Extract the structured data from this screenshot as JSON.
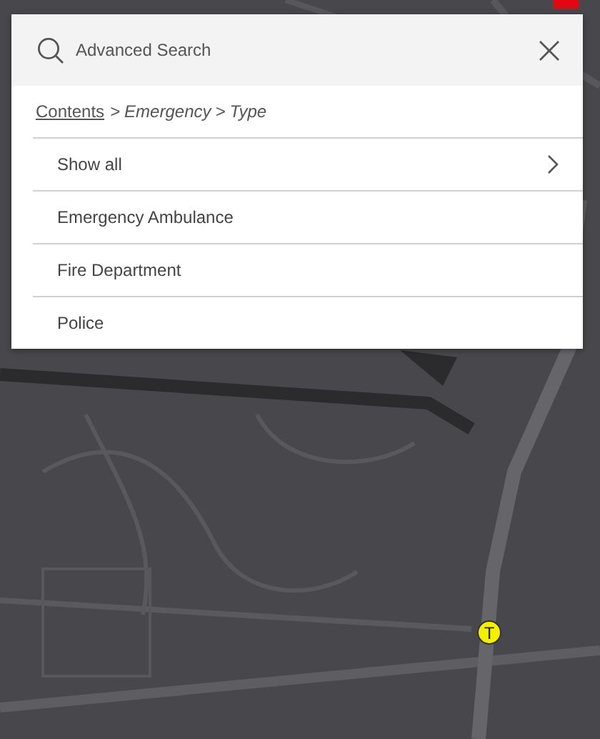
{
  "search": {
    "placeholder": "Advanced Search"
  },
  "breadcrumb": [
    {
      "kind": "link",
      "label": "Contents"
    },
    {
      "kind": "separator",
      "label": ">"
    },
    {
      "kind": "crumb",
      "label": "Emergency"
    },
    {
      "kind": "separator",
      "label": ">"
    },
    {
      "kind": "crumb",
      "label": "Type"
    }
  ],
  "items": [
    {
      "label": "Show all",
      "has_children": true
    },
    {
      "label": "Emergency Ambulance",
      "has_children": false
    },
    {
      "label": "Fire Department",
      "has_children": false
    },
    {
      "label": "Police",
      "has_children": false
    }
  ],
  "marker": {
    "label": "T"
  }
}
